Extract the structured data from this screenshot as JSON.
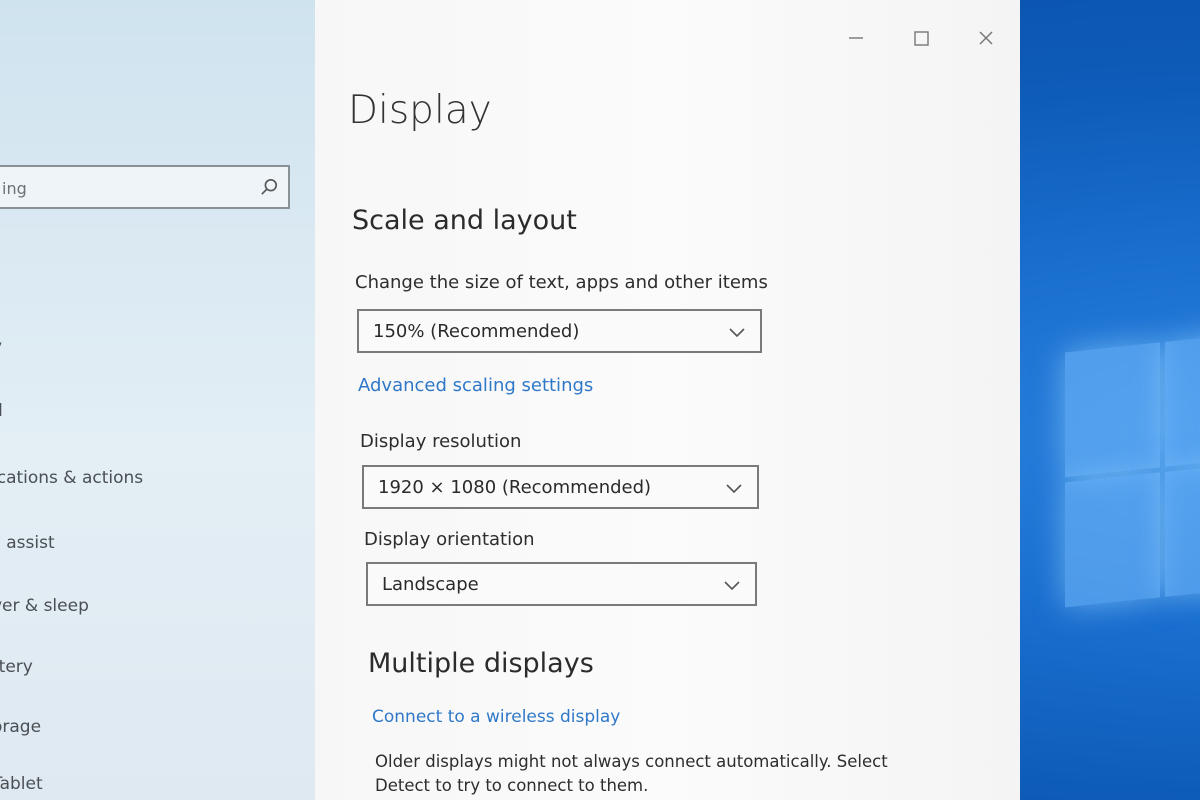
{
  "nav": {
    "search_value": "ing",
    "items": [
      {
        "label": "y"
      },
      {
        "label": "d"
      },
      {
        "label": "ications & actions"
      },
      {
        "label": "s assist"
      },
      {
        "label": "ver & sleep"
      },
      {
        "label": "ttery"
      },
      {
        "label": "orage"
      },
      {
        "label": "Tablet"
      }
    ]
  },
  "page": {
    "title": "Display",
    "scale_layout": {
      "heading": "Scale and layout",
      "size_label": "Change the size of text, apps and other items",
      "size_value": "150% (Recommended)",
      "advanced_link": "Advanced scaling settings",
      "resolution_label": "Display resolution",
      "resolution_value": "1920 × 1080 (Recommended)",
      "orientation_label": "Display orientation",
      "orientation_value": "Landscape"
    },
    "multiple_displays": {
      "heading": "Multiple displays",
      "wireless_link": "Connect to a wireless display",
      "description": "Older displays might not always connect automatically. Select Detect to try to connect to them."
    }
  },
  "colors": {
    "link": "#2f78c8",
    "nav_bg": "#d8e8f1",
    "content_bg": "#f7f7f7",
    "wallpaper": "#0b5fb8"
  },
  "icons": [
    "search-icon",
    "minimize-icon",
    "maximize-icon",
    "close-icon",
    "chevron-down-icon"
  ]
}
